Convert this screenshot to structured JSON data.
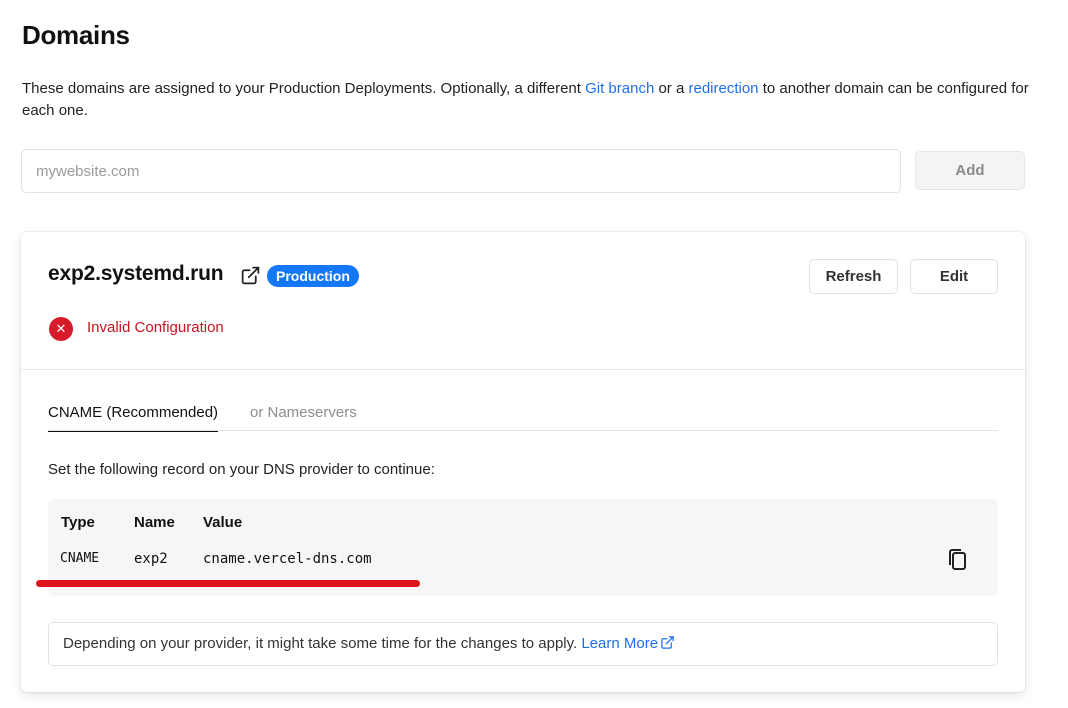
{
  "page": {
    "title": "Domains",
    "description_prefix": "These domains are assigned to your Production Deployments. Optionally, a different ",
    "git_branch_link": "Git branch",
    "description_middle": " or a ",
    "redirection_link": "redirection",
    "description_suffix": " to another domain can be configured for each one."
  },
  "add_domain": {
    "placeholder": "mywebsite.com",
    "value": "",
    "button_label": "Add"
  },
  "domain_card": {
    "domain": "exp2.systemd.run",
    "badge": "Production",
    "refresh_label": "Refresh",
    "edit_label": "Edit",
    "status_text": "Invalid Configuration",
    "status_icon": "x-icon",
    "tabs": [
      {
        "label": "CNAME (Recommended)",
        "active": true
      },
      {
        "label": "or Nameservers",
        "active": false
      }
    ],
    "instructions": "Set the following record on your DNS provider to continue:",
    "record_headers": {
      "type": "Type",
      "name": "Name",
      "value": "Value"
    },
    "record": {
      "type": "CNAME",
      "name": "exp2",
      "value": "cname.vercel-dns.com"
    },
    "note_text": "Depending on your provider, it might take some time for the changes to apply. ",
    "note_link": "Learn More"
  },
  "colors": {
    "link": "#1f6feb",
    "badge": "#1477f8",
    "error": "#c4141f",
    "annotation_mark": "#e0141e"
  }
}
